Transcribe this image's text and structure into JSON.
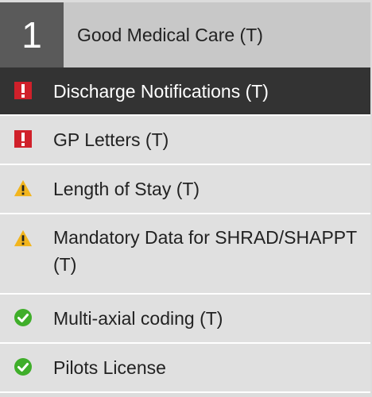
{
  "header": {
    "number": "1",
    "title": "Good Medical Care (T)"
  },
  "items": [
    {
      "label": "Discharge Notifications (T)",
      "status": "error",
      "icon": "error-icon"
    },
    {
      "label": "GP Letters (T)",
      "status": "error",
      "icon": "error-icon"
    },
    {
      "label": "Length of Stay (T)",
      "status": "warning",
      "icon": "warning-icon"
    },
    {
      "label": "Mandatory Data for SHRAD/SHAPPT (T)",
      "status": "warning",
      "icon": "warning-icon"
    },
    {
      "label": "Multi-axial coding (T)",
      "status": "ok",
      "icon": "check-circle-icon"
    },
    {
      "label": "Pilots License",
      "status": "ok",
      "icon": "check-circle-icon"
    }
  ],
  "colors": {
    "error": "#d0202a",
    "warning": "#f2b51d",
    "ok": "#3fae2a",
    "active_bg": "#333333",
    "header_num_bg": "#5a5a5a"
  }
}
